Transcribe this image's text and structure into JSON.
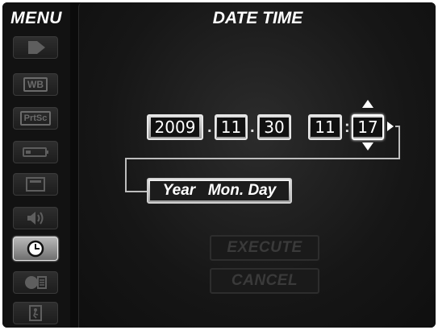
{
  "sidebar": {
    "title": "MENU",
    "items": [
      {
        "icon": "tag-icon"
      },
      {
        "icon": "wb-icon",
        "label": "WB"
      },
      {
        "icon": "prtsc-icon",
        "label": "PrtSc"
      },
      {
        "icon": "battery-icon"
      },
      {
        "icon": "display-icon"
      },
      {
        "icon": "speaker-icon"
      },
      {
        "icon": "clock-icon",
        "active": true
      },
      {
        "icon": "language-icon"
      },
      {
        "icon": "exit-icon"
      }
    ]
  },
  "main": {
    "title": "DATE TIME",
    "date": {
      "year": "2009",
      "month": "11",
      "day": "30",
      "separator": "."
    },
    "time": {
      "hour": "11",
      "minute": "17",
      "separator": ":"
    },
    "order": {
      "part1": "Year",
      "part2": "Mon. Day"
    },
    "buttons": {
      "execute": "EXECUTE",
      "cancel": "CANCEL"
    }
  }
}
